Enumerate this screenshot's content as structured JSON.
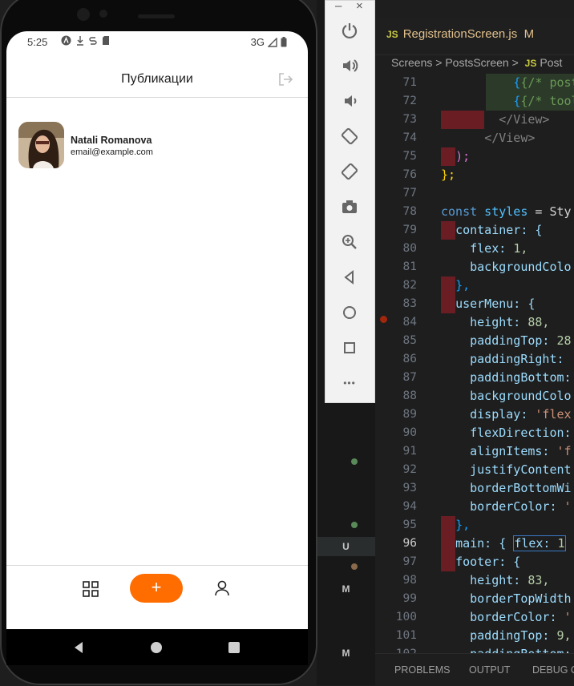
{
  "vscode": {
    "tab": {
      "name": "RegistrationScreen.js",
      "status": "M",
      "lang": "JS"
    },
    "breadcrumb": [
      "Screens",
      ">",
      "PostsScreen",
      ">",
      "JS",
      "Post"
    ],
    "line_numbers": [
      "71",
      "72",
      "73",
      "74",
      "75",
      "76",
      "77",
      "78",
      "79",
      "80",
      "81",
      "82",
      "83",
      "84",
      "85",
      "86",
      "87",
      "88",
      "89",
      "90",
      "91",
      "92",
      "93",
      "94",
      "95",
      "96",
      "97",
      "98",
      "99",
      "100",
      "101",
      "102"
    ],
    "current_line": "96",
    "activity_badges": {
      "u": "U",
      "m1": "M",
      "m2": "M"
    },
    "panel_tabs": {
      "problems": "PROBLEMS",
      "output": "OUTPUT",
      "debug": "DEBUG C"
    }
  },
  "code": {
    "l71": "{/* postli",
    "l72": "{/* toolba",
    "l73": "</View>",
    "l74": "</View>",
    "l75": ");",
    "l76": "};",
    "l78a": "const",
    "l78b": " styles",
    "l78c": " = Sty",
    "l79": "container: {",
    "l80a": "flex: ",
    "l80b": "1,",
    "l81": "backgroundColo",
    "l82": "},",
    "l83": "userMenu: {",
    "l84a": "height: ",
    "l84b": "88,",
    "l85a": "paddingTop: ",
    "l85b": "28",
    "l86": "paddingRight:",
    "l87": "paddingBottom:",
    "l88": "backgroundColo",
    "l89a": "display: ",
    "l89b": "'flex",
    "l90": "flexDirection:",
    "l91a": "alignItems: ",
    "l91b": "'f",
    "l92": "justifyContent",
    "l93": "borderBottomWi",
    "l94a": "borderColor: ",
    "l94b": "'",
    "l95": "},",
    "l96a": "main: { ",
    "l96b": "flex: ",
    "l96c": "1",
    "l97": "footer: {",
    "l98a": "height: ",
    "l98b": "83,",
    "l99": "borderTopWidth",
    "l100a": "borderColor: ",
    "l100b": "'",
    "l101a": "paddingTop: ",
    "l101b": "9,",
    "l102": "paddingBottom:"
  },
  "emulator": {
    "window_min": "–",
    "window_close": "×",
    "buttons": [
      "power-icon",
      "volume-up-icon",
      "volume-down-icon",
      "rotate-left-icon",
      "rotate-right-icon",
      "camera-icon",
      "zoom-icon",
      "back-icon",
      "home-icon",
      "overview-icon",
      "more-icon"
    ],
    "more_label": "•••"
  },
  "phone": {
    "status": {
      "time": "5:25",
      "network": "3G"
    },
    "header": {
      "title": "Публикации"
    },
    "user": {
      "name": "Natali Romanova",
      "email": "email@example.com"
    },
    "footer": {
      "add_label": "+"
    },
    "colors": {
      "accent": "#ff6c00"
    }
  }
}
